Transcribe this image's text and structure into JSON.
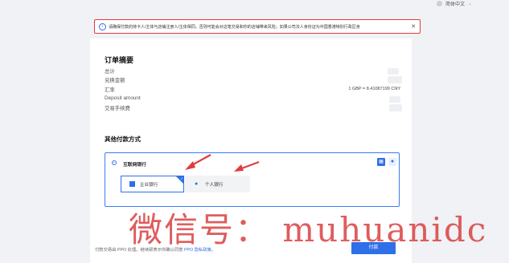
{
  "topbar": {
    "language": "简体中文"
  },
  "warning": {
    "text": "请确保付款的持卡人/主体与店铺注册人/主体相同。否则可能会对这笔交易和你的店铺带来风险；如果公司法人身份证为中国香港特别行政区身",
    "close": "✕"
  },
  "summary": {
    "title": "订单摘要",
    "rows": [
      "总计",
      "兑换金额",
      "汇率",
      "Deposit amount",
      "交易手续费"
    ],
    "rate": "1 GBP = 8.41087199 CNY"
  },
  "payment": {
    "section_title": "其他付款方式",
    "method_label": "互联网银行",
    "options": [
      {
        "label": "企业银行"
      },
      {
        "label": "个人银行"
      }
    ]
  },
  "footer": {
    "text_before": "付款交易由 PPO 处理。继续即表示你确认同意 ",
    "link": "PPO 隐私政策",
    "text_after": "。",
    "pay_button": "付款"
  },
  "watermark": "微信号： muhuanidc",
  "colors": {
    "accent": "#2f6fe8",
    "warning_border": "#e23b3b",
    "annotation": "#e23b3b"
  }
}
